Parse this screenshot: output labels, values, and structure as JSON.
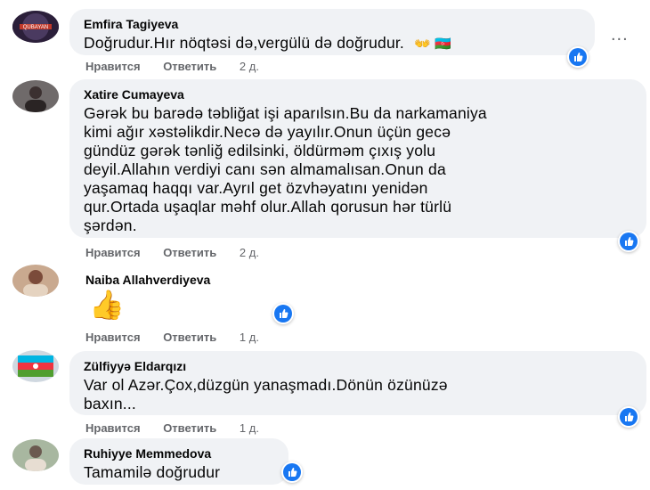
{
  "actions": {
    "like": "Нравится",
    "reply": "Ответить"
  },
  "more_label": "...",
  "comments": [
    {
      "author": "Emfira Tagiyeva",
      "lines": [
        "Doğrudur.Hır nöqtəsi də,vergülü də doğrudur."
      ],
      "emoji": "👐 🇦🇿",
      "time": "2 д."
    },
    {
      "author": "Xatire Cumayeva",
      "lines": [
        "Gərək bu barədə təbliğat işi aparılsın.Bu da narkamaniya",
        "kimi ağır xəstəlikdir.Necə də yayılır.Onun üçün gecə",
        "gündüz gərək tənliğ edilsinki, öldürməm çıxış yolu",
        "deyil.Allahın verdiyi canı sən almamalısan.Onun da",
        "yaşamaq haqqı var.Ayrıl get özvhəyatını yenidən",
        "qur.Ortada uşaqlar məhf olur.Allah qorusun hər türlü",
        "şərdən."
      ],
      "time": "2 д."
    },
    {
      "author": "Naiba Allahverdiyeva",
      "emoji": "👍",
      "time": "1 д."
    },
    {
      "author": "Zülfiyyə Eldarqızı",
      "lines": [
        "Var ol Azər.Çox,düzgün yanaşmadı.Dönün özünüzə",
        "baxın..."
      ],
      "time": "1 д."
    },
    {
      "author": "Ruhiyye Memmedova",
      "lines": [
        "Tamamilə doğrudur"
      ]
    }
  ],
  "colors": {
    "bubble": "#f0f2f5",
    "like_blue": "#1877f2",
    "meta_gray": "#65676b"
  }
}
